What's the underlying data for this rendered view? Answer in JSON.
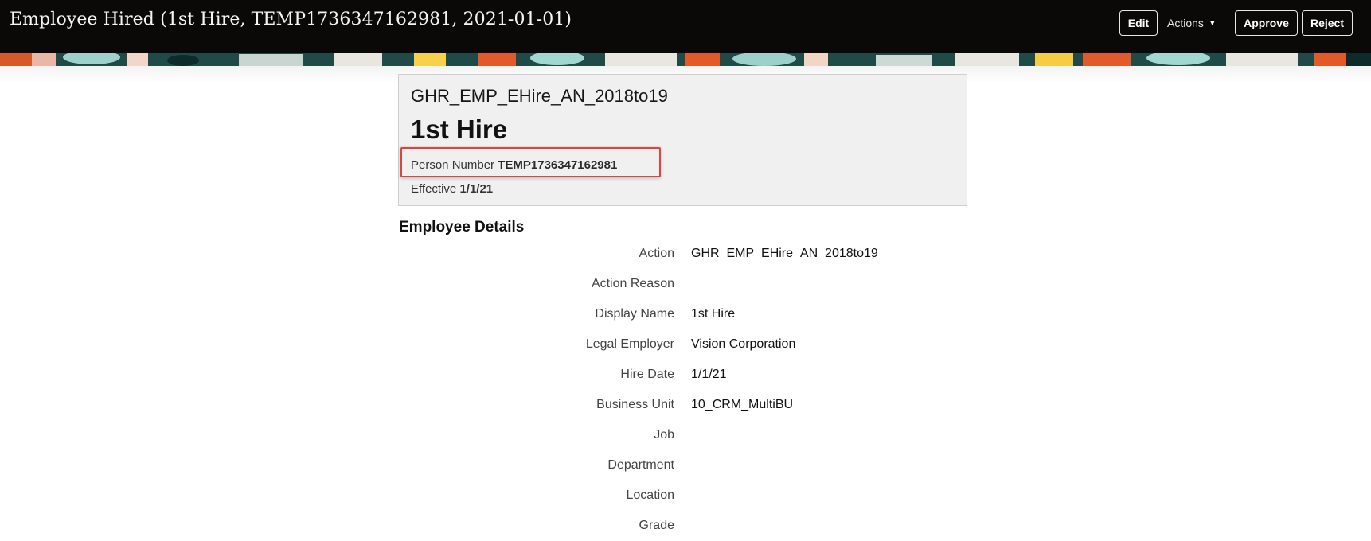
{
  "header": {
    "title": "Employee Hired (1st Hire, TEMP1736347162981, 2021-01-01)",
    "edit_label": "Edit",
    "actions_label": "Actions",
    "actions_icon": "caret-down-icon",
    "approve_label": "Approve",
    "reject_label": "Reject"
  },
  "summary": {
    "action_code": "GHR_EMP_EHire_AN_2018to19",
    "display_name": "1st Hire",
    "person_number_label": "Person Number",
    "person_number_value": "TEMP1736347162981",
    "effective_label": "Effective",
    "effective_value": "1/1/21",
    "highlight_color": "#e0423f"
  },
  "details": {
    "title": "Employee Details",
    "rows": [
      {
        "label": "Action",
        "value": "GHR_EMP_EHire_AN_2018to19"
      },
      {
        "label": "Action Reason",
        "value": ""
      },
      {
        "label": "Display Name",
        "value": "1st Hire"
      },
      {
        "label": "Legal Employer",
        "value": "Vision Corporation"
      },
      {
        "label": "Hire Date",
        "value": "1/1/21"
      },
      {
        "label": "Business Unit",
        "value": "10_CRM_MultiBU"
      },
      {
        "label": "Job",
        "value": ""
      },
      {
        "label": "Department",
        "value": ""
      },
      {
        "label": "Location",
        "value": ""
      },
      {
        "label": "Grade",
        "value": ""
      }
    ]
  }
}
